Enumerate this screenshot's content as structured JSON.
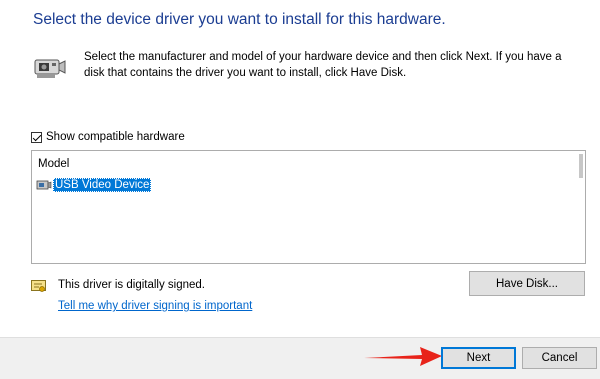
{
  "header": {
    "title": "Select the device driver you want to install for this hardware.",
    "description": "Select the manufacturer and model of your hardware device and then click Next. If you have a disk that contains the driver you want to install, click Have Disk."
  },
  "compatible": {
    "label": "Show compatible hardware",
    "checked": true
  },
  "model_list": {
    "header": "Model",
    "items": [
      {
        "label": "USB Video Device",
        "selected": true
      }
    ]
  },
  "signing": {
    "status_text": "This driver is digitally signed.",
    "link_text": "Tell me why driver signing is important"
  },
  "buttons": {
    "have_disk": "Have Disk...",
    "next": "Next",
    "cancel": "Cancel"
  },
  "colors": {
    "title": "#1b3d92",
    "selection": "#0078d7",
    "link": "#0066cc",
    "annotation_arrow": "#e8231a"
  }
}
